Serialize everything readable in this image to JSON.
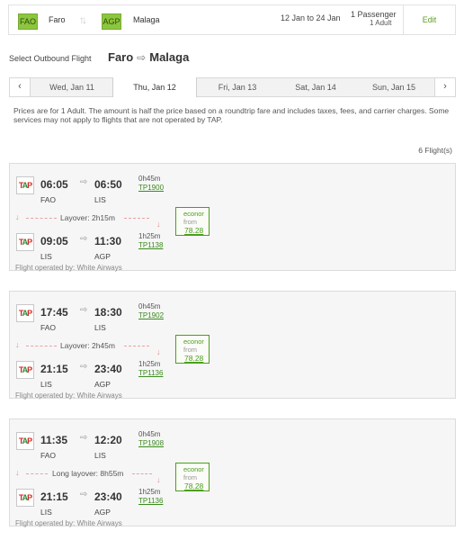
{
  "summary": {
    "origin_code": "FAO",
    "origin_city": "Faro",
    "destination_code": "AGP",
    "destination_city": "Malaga",
    "swap_glyph": "↑↓",
    "dates": "12 Jan to 24 Jan",
    "passengers": "1 Passenger",
    "passengers_detail": "1 Adult",
    "edit_label": "Edit"
  },
  "title": {
    "label": "Select Outbound Flight",
    "origin": "Faro",
    "destination": "Malaga",
    "arrow": "⇨"
  },
  "date_strip": {
    "prev": "‹",
    "next": "›",
    "days": [
      "Wed, Jan 11",
      "Thu, Jan 12",
      "Fri, Jan 13",
      "Sat, Jan 14",
      "Sun, Jan 15"
    ],
    "selected_index": 1
  },
  "note": "Prices are for 1 Adult. The amount is half the price based on a roundtrip fare and includes taxes, fees, and carrier charges. Some services may not apply to flights that are not operated by TAP.",
  "flight_count": "6 Flight(s)",
  "plane_glyph": "⇨",
  "down_glyph": "↓",
  "flights": [
    {
      "seg1": {
        "dep": "06:05",
        "arr": "06:50",
        "from": "FAO",
        "to": "LIS",
        "duration": "0h45m",
        "flight_no": "TP1900"
      },
      "layover": "Layover: 2h15m",
      "seg2": {
        "dep": "09:05",
        "arr": "11:30",
        "from": "LIS",
        "to": "AGP",
        "duration": "1h25m",
        "flight_no": "TP1138"
      },
      "operated_by": "Flight operated by: White Airways",
      "fare": {
        "cabin": "econor",
        "from": "from",
        "price": "78.28"
      }
    },
    {
      "seg1": {
        "dep": "17:45",
        "arr": "18:30",
        "from": "FAO",
        "to": "LIS",
        "duration": "0h45m",
        "flight_no": "TP1902"
      },
      "layover": "Layover: 2h45m",
      "seg2": {
        "dep": "21:15",
        "arr": "23:40",
        "from": "LIS",
        "to": "AGP",
        "duration": "1h25m",
        "flight_no": "TP1136"
      },
      "operated_by": "Flight operated by: White Airways",
      "fare": {
        "cabin": "econor",
        "from": "from",
        "price": "78.28"
      }
    },
    {
      "seg1": {
        "dep": "11:35",
        "arr": "12:20",
        "from": "FAO",
        "to": "LIS",
        "duration": "0h45m",
        "flight_no": "TP1908"
      },
      "layover": "Long layover: 8h55m",
      "seg2": {
        "dep": "21:15",
        "arr": "23:40",
        "from": "LIS",
        "to": "AGP",
        "duration": "1h25m",
        "flight_no": "TP1136"
      },
      "operated_by": "Flight operated by: White Airways",
      "fare": {
        "cabin": "econor",
        "from": "from",
        "price": "78.28"
      }
    }
  ]
}
